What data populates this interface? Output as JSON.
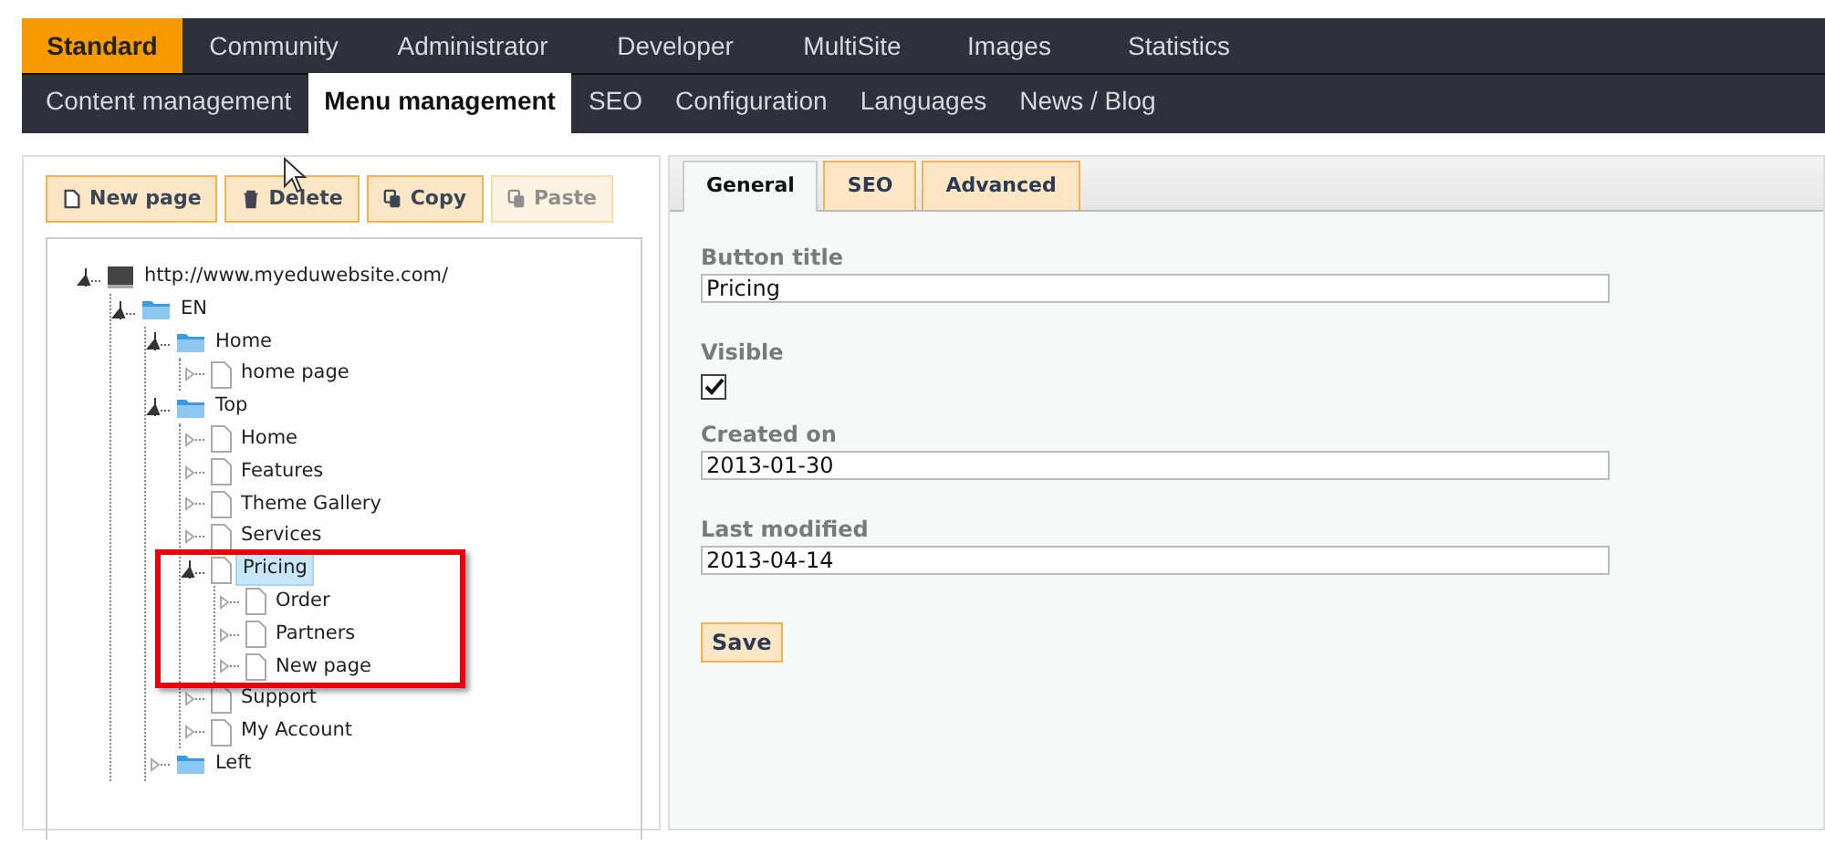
{
  "main_menu": [
    {
      "label": "Standard",
      "selected": true
    },
    {
      "label": "Community",
      "selected": false
    },
    {
      "label": "Administrator",
      "selected": false
    },
    {
      "label": "Developer",
      "selected": false
    },
    {
      "label": "MultiSite",
      "selected": false
    },
    {
      "label": "Images",
      "selected": false
    },
    {
      "label": "Statistics",
      "selected": false
    }
  ],
  "sub_menu": [
    {
      "label": "Content management",
      "selected": false
    },
    {
      "label": "Menu management",
      "selected": true
    },
    {
      "label": "SEO",
      "selected": false
    },
    {
      "label": "Configuration",
      "selected": false
    },
    {
      "label": "Languages",
      "selected": false
    },
    {
      "label": "News / Blog",
      "selected": false
    }
  ],
  "toolbar": [
    {
      "label": "New page",
      "kind": "page",
      "disabled": false
    },
    {
      "label": "Delete",
      "kind": "trash",
      "disabled": false
    },
    {
      "label": "Copy",
      "kind": "copy",
      "disabled": false
    },
    {
      "label": "Paste",
      "kind": "copy",
      "disabled": true
    }
  ],
  "tree": [
    {
      "label": "http://www.myeduwebsite.com/",
      "kind": "site",
      "expanded": true,
      "selected": false,
      "children": [
        {
          "label": "EN",
          "kind": "folder",
          "expanded": true,
          "selected": false,
          "children": [
            {
              "label": "Home",
              "kind": "folder",
              "expanded": true,
              "selected": false,
              "children": [
                {
                  "label": "home page",
                  "kind": "page",
                  "expanded": false,
                  "selected": false
                }
              ]
            },
            {
              "label": "Top",
              "kind": "folder",
              "expanded": true,
              "selected": false,
              "children": [
                {
                  "label": "Home",
                  "kind": "page",
                  "expanded": false,
                  "selected": false
                },
                {
                  "label": "Features",
                  "kind": "page",
                  "expanded": false,
                  "selected": false
                },
                {
                  "label": "Theme Gallery",
                  "kind": "page",
                  "expanded": false,
                  "selected": false
                },
                {
                  "label": "Services",
                  "kind": "page",
                  "expanded": false,
                  "selected": false
                },
                {
                  "label": "Pricing",
                  "kind": "page",
                  "expanded": true,
                  "selected": true,
                  "highlighted": true,
                  "children": [
                    {
                      "label": "Order",
                      "kind": "page",
                      "expanded": false,
                      "selected": false
                    },
                    {
                      "label": "Partners",
                      "kind": "page",
                      "expanded": false,
                      "selected": false
                    },
                    {
                      "label": "New page",
                      "kind": "page",
                      "expanded": false,
                      "selected": false
                    }
                  ]
                },
                {
                  "label": "Support",
                  "kind": "page",
                  "expanded": false,
                  "selected": false
                },
                {
                  "label": "My Account",
                  "kind": "page",
                  "expanded": false,
                  "selected": false
                }
              ]
            },
            {
              "label": "Left",
              "kind": "folder",
              "expanded": false,
              "selected": false
            }
          ]
        }
      ]
    }
  ],
  "editor": {
    "tabs": [
      {
        "label": "General",
        "selected": true
      },
      {
        "label": "SEO",
        "selected": false
      },
      {
        "label": "Advanced",
        "selected": false
      }
    ],
    "fields": [
      {
        "kind": "text",
        "label": "Button title",
        "value": "Pricing"
      },
      {
        "kind": "checkbox",
        "label": "Visible",
        "checked": true
      },
      {
        "kind": "text",
        "label": "Created on",
        "value": "2013-01-30"
      },
      {
        "kind": "text",
        "label": "Last modified",
        "value": "2013-04-14"
      }
    ],
    "save_button": "Save"
  }
}
